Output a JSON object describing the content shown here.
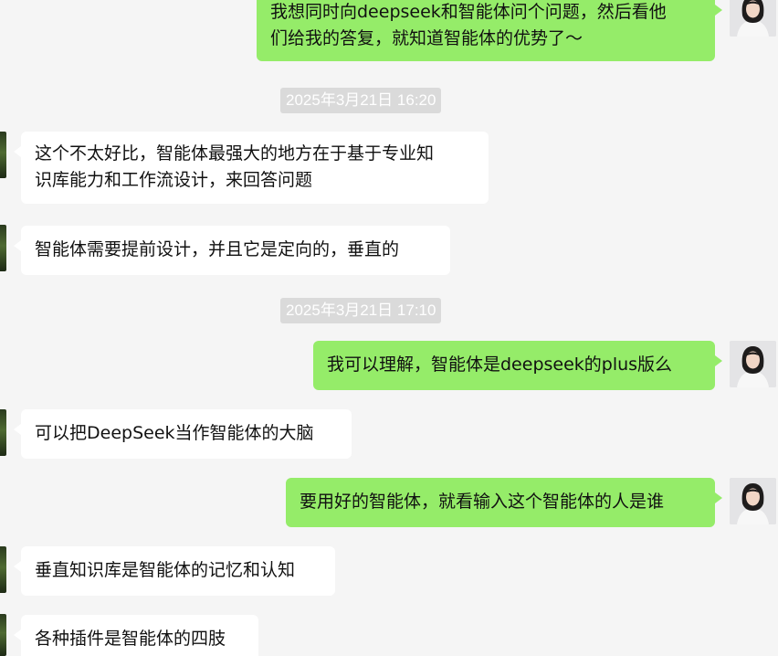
{
  "conversation": {
    "messages": [
      {
        "direction": "out",
        "lines": [
          "我想同时向deepseek和智能体问个问题，然后看他",
          "们给我的答复，就知道智能体的优势了～"
        ]
      },
      {
        "direction": "in",
        "lines": [
          "这个不太好比，智能体最强大的地方在于基于专业知",
          "识库能力和工作流设计，来回答问题"
        ]
      },
      {
        "direction": "in",
        "lines": [
          "智能体需要提前设计，并且它是定向的，垂直的"
        ]
      },
      {
        "direction": "out",
        "lines": [
          "我可以理解，智能体是deepseek的plus版么"
        ]
      },
      {
        "direction": "in",
        "lines": [
          "可以把DeepSeek当作智能体的大脑"
        ]
      },
      {
        "direction": "out",
        "lines": [
          "要用好的智能体，就看输入这个智能体的人是谁"
        ]
      },
      {
        "direction": "in",
        "lines": [
          "垂直知识库是智能体的记忆和认知"
        ]
      },
      {
        "direction": "in",
        "lines": [
          "各种插件是智能体的四肢"
        ]
      }
    ],
    "timestamps": [
      "2025年3月21日 16:20",
      "2025年3月21日 17:10"
    ]
  },
  "colors": {
    "background": "#f5f5f5",
    "outgoing_bubble": "#95ec69",
    "incoming_bubble": "#ffffff",
    "timestamp_bg": "#dadada",
    "timestamp_text": "#ffffff"
  }
}
